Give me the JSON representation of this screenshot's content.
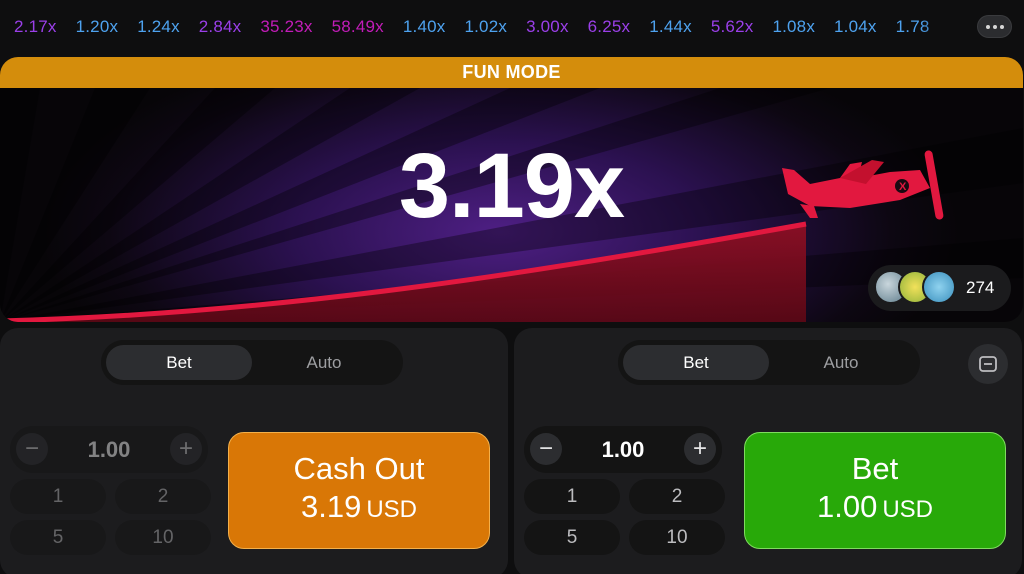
{
  "history": {
    "items": [
      {
        "value": "2.17x",
        "color": "#9a3fe8"
      },
      {
        "value": "1.20x",
        "color": "#4ea2ef"
      },
      {
        "value": "1.24x",
        "color": "#4ea2ef"
      },
      {
        "value": "2.84x",
        "color": "#9a3fe8"
      },
      {
        "value": "35.23x",
        "color": "#c21cb8"
      },
      {
        "value": "58.49x",
        "color": "#c21cb8"
      },
      {
        "value": "1.40x",
        "color": "#4ea2ef"
      },
      {
        "value": "1.02x",
        "color": "#4ea2ef"
      },
      {
        "value": "3.00x",
        "color": "#9a3fe8"
      },
      {
        "value": "6.25x",
        "color": "#9a3fe8"
      },
      {
        "value": "1.44x",
        "color": "#4ea2ef"
      },
      {
        "value": "5.62x",
        "color": "#9a3fe8"
      },
      {
        "value": "1.08x",
        "color": "#4ea2ef"
      },
      {
        "value": "1.04x",
        "color": "#4ea2ef"
      },
      {
        "value": "1.78",
        "color": "#4ea2ef"
      }
    ],
    "more_icon": "ellipsis-icon"
  },
  "game": {
    "mode_banner": "FUN MODE",
    "multiplier": "3.19x",
    "plane_icon": "airplane-icon",
    "online_count": "274",
    "colors": {
      "banner": "#d48d0c",
      "curve": "#e2183f"
    }
  },
  "panels": [
    {
      "tabs": {
        "bet": "Bet",
        "auto": "Auto"
      },
      "amount": "1.00",
      "quick_amounts": [
        "1",
        "2",
        "5",
        "10"
      ],
      "action": {
        "title": "Cash Out",
        "amount": "3.19",
        "currency": "USD",
        "color": "#d97706"
      }
    },
    {
      "tabs": {
        "bet": "Bet",
        "auto": "Auto"
      },
      "amount": "1.00",
      "quick_amounts": [
        "1",
        "2",
        "5",
        "10"
      ],
      "action": {
        "title": "Bet",
        "amount": "1.00",
        "currency": "USD",
        "color": "#28a909"
      },
      "collapse_icon": "minus-square-icon"
    }
  ]
}
